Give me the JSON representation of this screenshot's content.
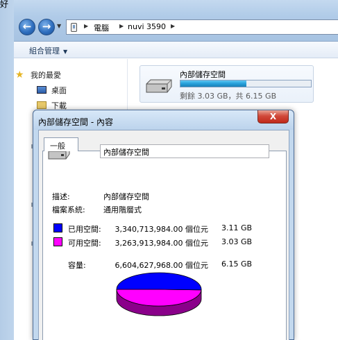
{
  "window": {
    "title_fragment": "好"
  },
  "address": {
    "crumbs": [
      "電腦",
      "nuvi 3590"
    ]
  },
  "toolbar": {
    "organize_label": "組合管理"
  },
  "nav": {
    "favorites_label": "我的最愛",
    "items": [
      {
        "label": "桌面"
      },
      {
        "label": "下載"
      }
    ]
  },
  "drive_tile": {
    "name": "內部儲存空間",
    "free_text": "剩餘 3.03 GB，共 6.15 GB",
    "used_fraction": 0.507
  },
  "dialog": {
    "title": "內部儲存空間 - 內容",
    "close_label": "X",
    "tab_label": "一般",
    "name_value": "內部儲存空間",
    "desc_label": "描述:",
    "desc_value": "內部儲存空間",
    "fs_label": "檔案系統:",
    "fs_value": "通用階層式",
    "used": {
      "label": "已用空間:",
      "bytes": "3,340,713,984.00 個位元",
      "size": "3.11 GB",
      "color": "#0000ff"
    },
    "free": {
      "label": "可用空間:",
      "bytes": "3,263,913,984.00 個位元",
      "size": "3.03 GB",
      "color": "#ff00ff"
    },
    "capacity": {
      "label": "容量:",
      "bytes": "6,604,627,968.00 個位元",
      "size": "6.15 GB"
    },
    "pie": {
      "used_fraction": 0.506
    }
  }
}
